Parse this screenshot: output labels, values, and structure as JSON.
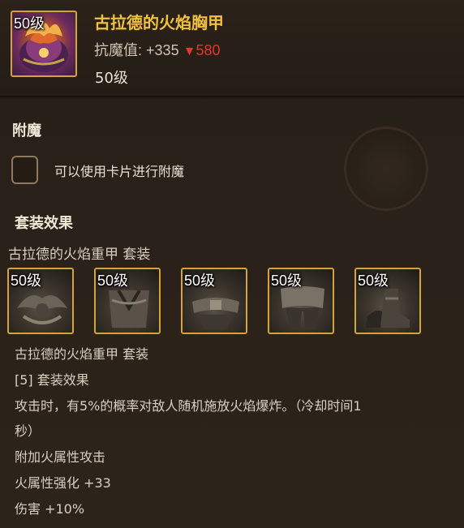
{
  "item": {
    "level_badge": "50级",
    "name": "古拉德的火焰胸甲",
    "stat_label": "抗魔值:",
    "stat_value": "+335",
    "stat_arrow": "▼",
    "stat_diff": "580",
    "level": "50级",
    "icon": "flame-chest-armor-icon"
  },
  "enchant": {
    "title": "附魔",
    "hint": "可以使用卡片进行附魔"
  },
  "set_effect": {
    "title": "套装效果",
    "set_name": "古拉德的火焰重甲  套装",
    "pieces": [
      {
        "level": "50级",
        "icon": "shoulder-armor-icon"
      },
      {
        "level": "50级",
        "icon": "chest-armor-icon"
      },
      {
        "level": "50级",
        "icon": "belt-armor-icon"
      },
      {
        "level": "50级",
        "icon": "leg-armor-icon"
      },
      {
        "level": "50级",
        "icon": "boots-armor-icon"
      }
    ],
    "desc_set_name": "古拉德的火焰重甲  套装",
    "bonus_header": "[5] 套装效果",
    "bonus_line1": "攻击时，有5%的概率对敌人随机施放火焰爆炸。（冷却时间1",
    "bonus_line2": "秒）",
    "bonus_line3": "附加火属性攻击",
    "bonus_line4": "火属性强化 +33",
    "bonus_line5": "伤害 +10%"
  },
  "colors": {
    "title_gold": "#f2c23c",
    "stat_down_red": "#e8342a",
    "frame_gold": "#d4a43a"
  }
}
